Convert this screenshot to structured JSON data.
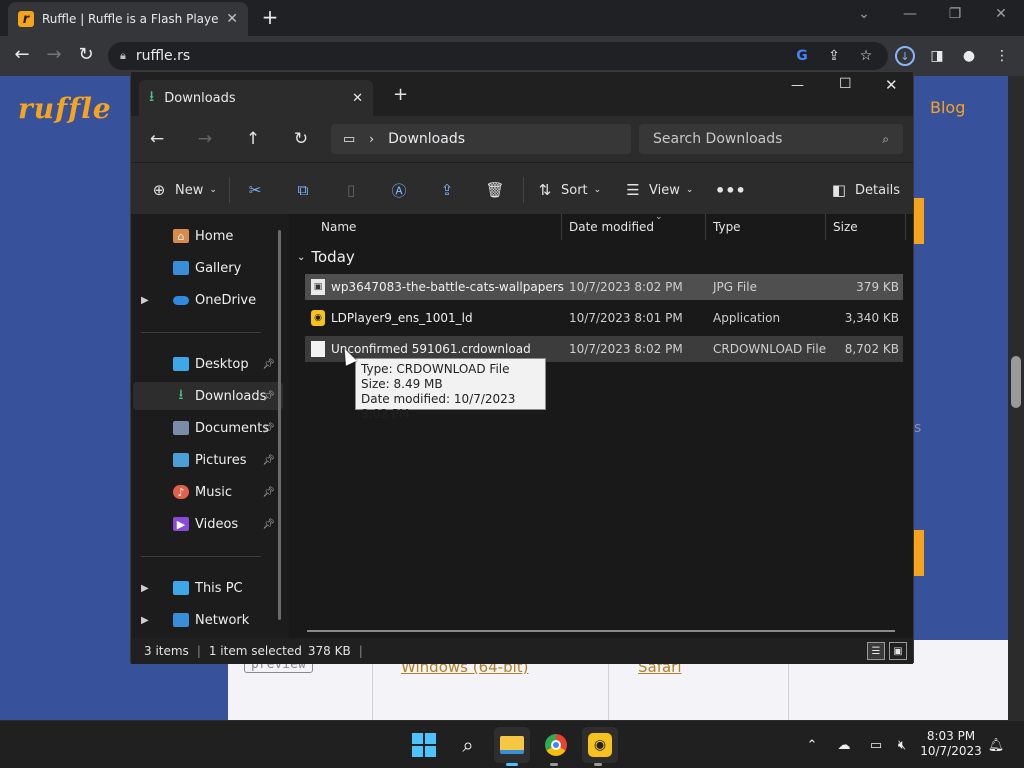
{
  "browser": {
    "tab_title": "Ruffle | Ruffle is a Flash Player em",
    "tab_favicon_letter": "r",
    "new_tab_symbol": "+",
    "url": "ruffle.rs"
  },
  "webpage": {
    "logo": "ruffle",
    "nav_link": "Blog",
    "preview_tag": "preview",
    "links": [
      "Windows (64-bit)",
      "Safari"
    ],
    "partial_text": "s"
  },
  "explorer": {
    "tab_label": "Downloads",
    "path_current": "Downloads",
    "search_placeholder": "Search Downloads",
    "commands": {
      "new": "New",
      "sort": "Sort",
      "view": "View",
      "details": "Details"
    },
    "sidebar": [
      {
        "label": "Home",
        "icon": "home-icon"
      },
      {
        "label": "Gallery",
        "icon": "gallery-icon"
      },
      {
        "label": "OneDrive",
        "icon": "onedrive-icon"
      },
      {
        "label": "Desktop",
        "icon": "desktop-icon"
      },
      {
        "label": "Downloads",
        "icon": "downloads-icon"
      },
      {
        "label": "Documents",
        "icon": "documents-icon"
      },
      {
        "label": "Pictures",
        "icon": "pictures-icon"
      },
      {
        "label": "Music",
        "icon": "music-icon"
      },
      {
        "label": "Videos",
        "icon": "videos-icon"
      },
      {
        "label": "This PC",
        "icon": "this-pc-icon"
      },
      {
        "label": "Network",
        "icon": "network-icon"
      }
    ],
    "columns": [
      "Name",
      "Date modified",
      "Type",
      "Size"
    ],
    "group": "Today",
    "files": [
      {
        "name": "wp3647083-the-battle-cats-wallpapers",
        "date": "10/7/2023 8:02 PM",
        "type": "JPG File",
        "size": "379 KB"
      },
      {
        "name": "LDPlayer9_ens_1001_ld",
        "date": "10/7/2023 8:01 PM",
        "type": "Application",
        "size": "3,340 KB"
      },
      {
        "name": "Unconfirmed 591061.crdownload",
        "date": "10/7/2023 8:02 PM",
        "type": "CRDOWNLOAD File",
        "size": "8,702 KB"
      }
    ],
    "tooltip": {
      "type": "Type: CRDOWNLOAD File",
      "size": "Size: 8.49 MB",
      "date": "Date modified: 10/7/2023 8:02 PM"
    },
    "status": {
      "items": "3 items",
      "selected": "1 item selected",
      "selected_size": "378 KB"
    }
  },
  "taskbar": {
    "time": "8:03 PM",
    "date": "10/7/2023"
  }
}
